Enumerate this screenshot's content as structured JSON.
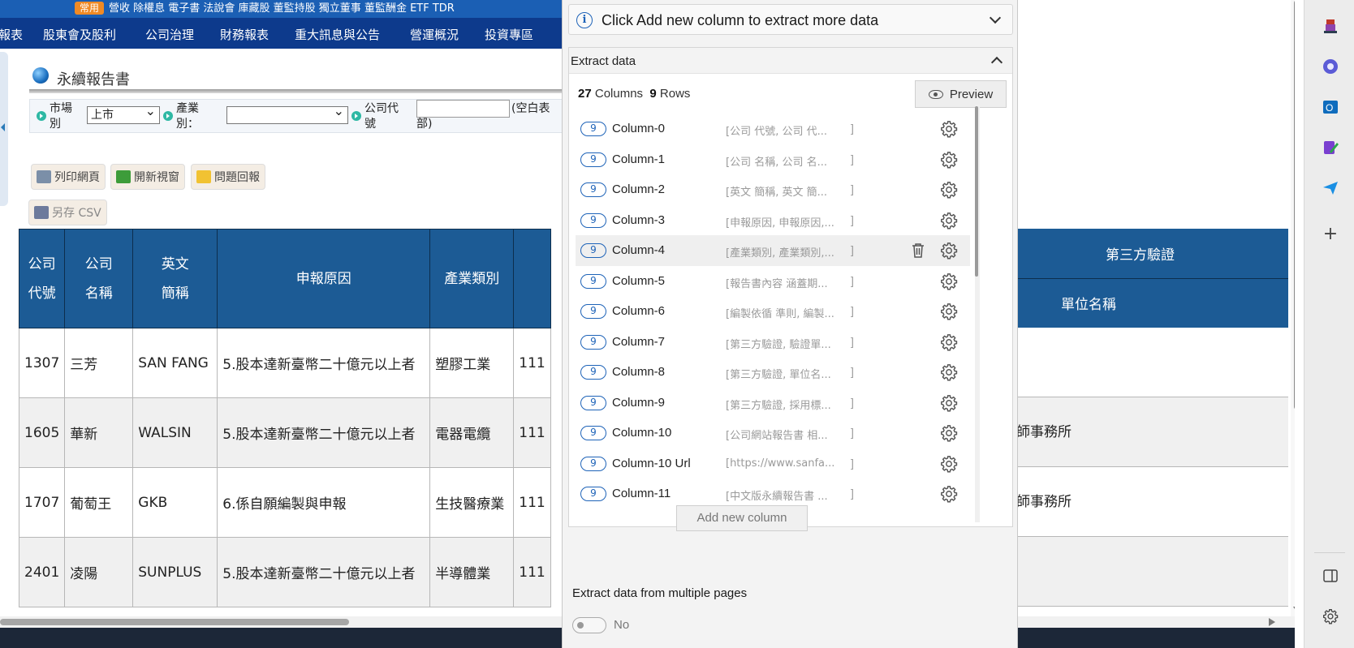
{
  "webpage": {
    "banner": {
      "tag": "常用",
      "text": "營收 除權息 電子書 法說會 庫藏股 董監持股 獨立董事 董監酬金 ETF TDR"
    },
    "nav": [
      "報表",
      "股東會及股利",
      "公司治理",
      "財務報表",
      "重大訊息與公告",
      "營運概況",
      "投資專區"
    ],
    "title": "永續報告書",
    "filters": {
      "market_label_1": "市場",
      "market_label_2": "別",
      "market_value": "上市",
      "industry_label_1": "產業",
      "industry_label_2": "別：",
      "industry_value": "",
      "code_label_1": "公司代",
      "code_label_2": "號",
      "code_hint_1": "(空白表",
      "code_hint_2": "部)"
    },
    "buttons": {
      "print": "列印網頁",
      "new_window": "開新視窗",
      "feedback": "問題回報",
      "save_csv": "另存 CSV"
    },
    "table": {
      "headers": {
        "code_1": "公司",
        "code_2": "代號",
        "name_1": "公司",
        "name_2": "名稱",
        "abbr_1": "英文",
        "abbr_2": "簡稱",
        "reason": "申報原因",
        "industry": "產業類別",
        "third_party": "第三方驗證",
        "unit_name": "單位名稱"
      },
      "rows": [
        {
          "code": "1307",
          "name": "三芳",
          "abbr": "SAN FANG",
          "reason": "5.股本達新臺幣二十億元以上者",
          "industry": "塑膠工業",
          "partial": "111",
          "unit": ""
        },
        {
          "code": "1605",
          "name": "華新",
          "abbr": "WALSIN",
          "reason": "5.股本達新臺幣二十億元以上者",
          "industry": "電器電纜",
          "partial": "111",
          "unit": "師事務所"
        },
        {
          "code": "1707",
          "name": "葡萄王",
          "abbr": "GKB",
          "reason": "6.係自願編製與申報",
          "industry": "生技醫療業",
          "partial": "111",
          "unit": "師事務所"
        },
        {
          "code": "2401",
          "name": "凌陽",
          "abbr": "SUNPLUS",
          "reason": "5.股本達新臺幣二十億元以上者",
          "industry": "半導體業",
          "partial": "111",
          "unit": ""
        }
      ]
    }
  },
  "panel": {
    "info_text": "Click Add new column to extract more data",
    "section_title": "Extract data",
    "columns_count": "27",
    "columns_label": "Columns",
    "rows_count": "9",
    "rows_label": "Rows",
    "preview_label": "Preview",
    "columns": [
      {
        "badge": "9",
        "name": "Column-0",
        "sample": "[公司 代號, 公司 代...",
        "close": "]"
      },
      {
        "badge": "9",
        "name": "Column-1",
        "sample": "[公司 名稱, 公司 名...",
        "close": "]"
      },
      {
        "badge": "9",
        "name": "Column-2",
        "sample": "[英文 簡稱, 英文 簡...",
        "close": "]"
      },
      {
        "badge": "9",
        "name": "Column-3",
        "sample": "[申報原因, 申報原因,...",
        "close": "]"
      },
      {
        "badge": "9",
        "name": "Column-4",
        "sample": "[產業類別, 產業類別,...",
        "close": "]"
      },
      {
        "badge": "9",
        "name": "Column-5",
        "sample": "[報告書內容 涵蓋期...",
        "close": "]"
      },
      {
        "badge": "9",
        "name": "Column-6",
        "sample": "[編製依循 準則, 編製...",
        "close": "]"
      },
      {
        "badge": "9",
        "name": "Column-7",
        "sample": "[第三方驗證, 驗證單...",
        "close": "]"
      },
      {
        "badge": "9",
        "name": "Column-8",
        "sample": "[第三方驗證, 單位名...",
        "close": "]"
      },
      {
        "badge": "9",
        "name": "Column-9",
        "sample": "[第三方驗證, 採用標...",
        "close": "]"
      },
      {
        "badge": "9",
        "name": "Column-10",
        "sample": "[公司網站報告書 相...",
        "close": "]"
      },
      {
        "badge": "9",
        "name": "Column-10 Url",
        "sample": "[https://www.sanfa...",
        "close": "]"
      },
      {
        "badge": "9",
        "name": "Column-11",
        "sample": "[中文版永續報告書 ...",
        "close": "]"
      }
    ],
    "add_column_label": "Add new column",
    "multi_page_title": "Extract data from multiple pages",
    "multi_page_toggle_label": "No"
  },
  "colors": {
    "accent": "#1e63b8",
    "table_header": "#1c5b95",
    "nav": "#0d3a8c"
  }
}
